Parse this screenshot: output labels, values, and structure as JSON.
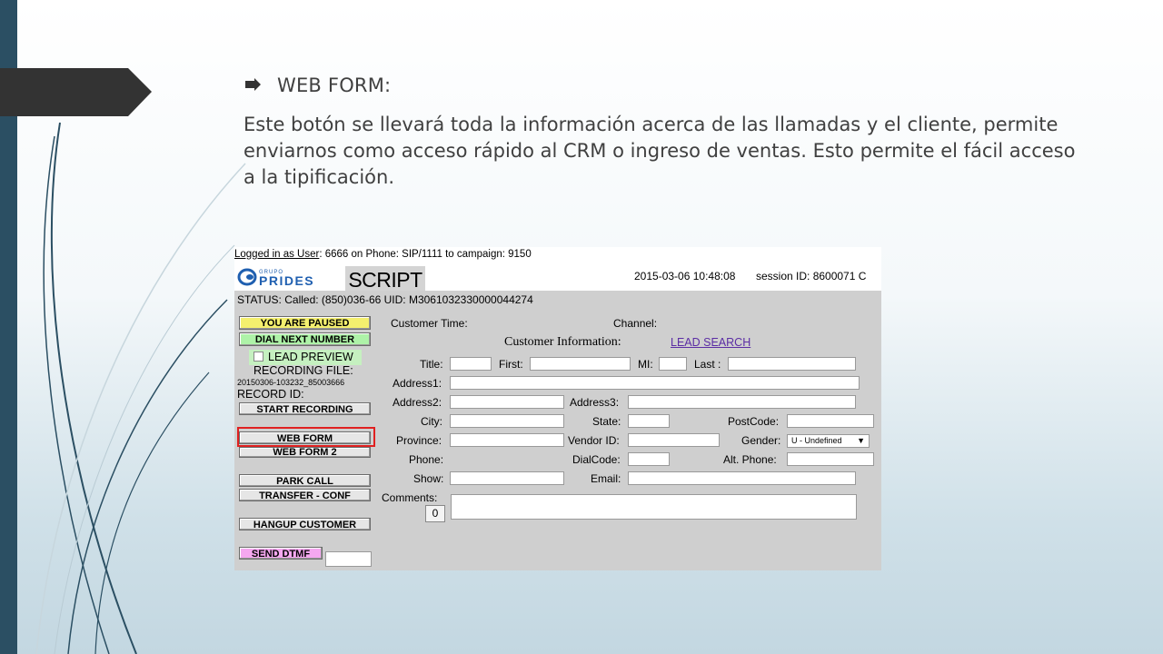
{
  "slide": {
    "heading": "WEB FORM:",
    "body": "Este botón se llevará toda la información acerca de las llamadas y el cliente, permite enviarnos como acceso rápido al CRM o ingreso de ventas. Esto permite el fácil acceso a la tipificación."
  },
  "agent": {
    "logged_label": "Logged in as User",
    "logged_rest": ": 6666 on Phone: SIP/1111  to campaign: 9150",
    "script_tab": "SCRIPT",
    "datetime": "2015-03-06 10:48:08",
    "session": "session ID: 8600071   C",
    "status": "STATUS: Called: (850)036-66 UID: M3061032330000044274",
    "buttons": {
      "paused": "YOU ARE PAUSED",
      "dial_next": "DIAL NEXT NUMBER",
      "lead_preview": "LEAD PREVIEW",
      "recording_file_label": "RECORDING FILE:",
      "recording_file": "20150306-103232_85003666",
      "record_id_label": "RECORD ID:",
      "start_recording": "START RECORDING",
      "web_form": "WEB FORM",
      "web_form_2": "WEB FORM 2",
      "park_call": "PARK CALL",
      "transfer": "TRANSFER - CONF",
      "hangup": "HANGUP CUSTOMER",
      "send_dtmf": "SEND DTMF"
    },
    "form": {
      "customer_time": "Customer Time:",
      "channel": "Channel:",
      "customer_info": "Customer Information:",
      "lead_search": "LEAD SEARCH",
      "title": "Title:",
      "first": "First:",
      "mi": "MI:",
      "last": "Last :",
      "address1": "Address1:",
      "address2": "Address2:",
      "address3": "Address3:",
      "city": "City:",
      "state": "State:",
      "postcode": "PostCode:",
      "province": "Province:",
      "vendor_id": "Vendor ID:",
      "gender": "Gender:",
      "gender_value": "U - Undefined",
      "phone": "Phone:",
      "dialcode": "DialCode:",
      "alt_phone": "Alt. Phone:",
      "show": "Show:",
      "email": "Email:",
      "comments": "Comments:",
      "zero": "0"
    }
  },
  "logo_text": {
    "grupo": "GRUPO",
    "prides": "PRIDES"
  },
  "colors": {
    "left_band": "#2b4f63",
    "tab": "#333333",
    "highlight": "#e02020"
  }
}
